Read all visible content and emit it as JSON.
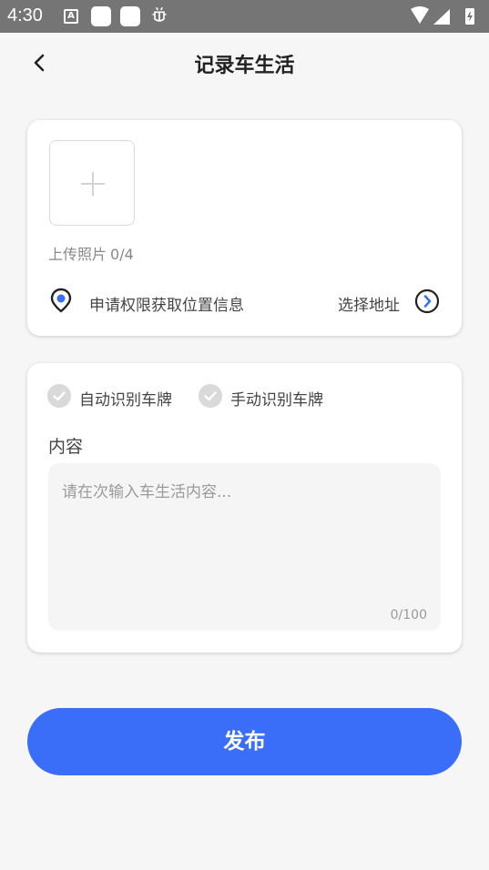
{
  "status_bar": {
    "time": "4:30",
    "a_badge": "A"
  },
  "header": {
    "title": "记录车生活"
  },
  "upload": {
    "label": "上传照片",
    "count": "0/4"
  },
  "location": {
    "request_text": "申请权限获取位置信息",
    "select_address": "选择地址"
  },
  "plate_options": [
    {
      "label": "自动识别车牌"
    },
    {
      "label": "手动识别车牌"
    }
  ],
  "content": {
    "label": "内容",
    "placeholder": "请在次输入车生活内容...",
    "counter": "0/100"
  },
  "publish_button": {
    "label": "发布"
  },
  "colors": {
    "accent": "#3a6ef8",
    "background": "#f6f6f6",
    "status_bar": "#757575"
  }
}
